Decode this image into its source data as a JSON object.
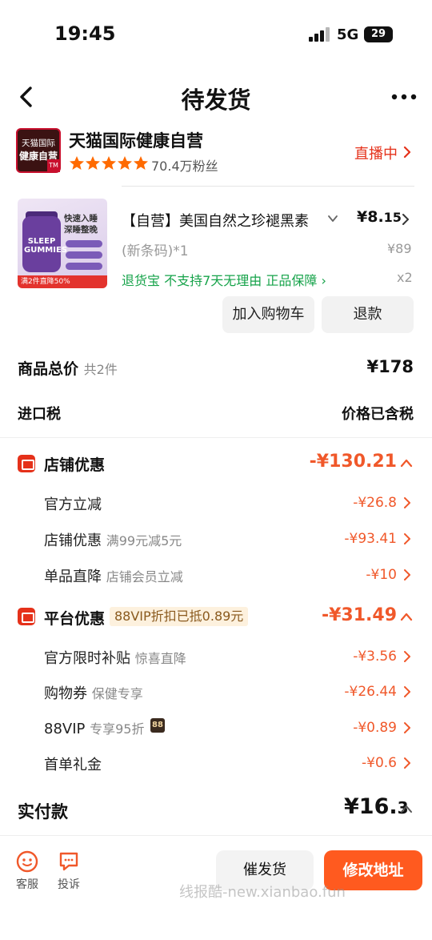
{
  "status_bar": {
    "time": "19:45",
    "network": "5G",
    "battery": "29"
  },
  "nav": {
    "title": "待发货"
  },
  "shop": {
    "logo_line1": "天猫国际",
    "logo_line2": "健康自营",
    "name": "天猫国际健康自营",
    "followers": "70.4万粉丝",
    "live_label": "直播中",
    "rating_stars": 5
  },
  "product": {
    "image_headline": "快速入睡 深睡整晚",
    "image_bottle_text": "SLEEP GUMMIES",
    "image_promo": "满2件直降50%",
    "title": "【自营】美国自然之珍褪黑素",
    "price_main": "¥8.",
    "price_decimal": "15",
    "variant": "(新条码)*1",
    "original_price": "¥89",
    "services": "退货宝  不支持7天无理由  正品保障",
    "quantity": "x2",
    "add_cart": "加入购物车",
    "refund": "退款"
  },
  "summary": {
    "total_label": "商品总价",
    "total_count": "共2件",
    "total_value": "¥178",
    "tax_label": "进口税",
    "tax_value": "价格已含税"
  },
  "store_discount": {
    "title": "店铺优惠",
    "amount": "-¥130.21",
    "items": [
      {
        "label": "官方立减",
        "sub": "",
        "amount": "-¥26.8"
      },
      {
        "label": "店铺优惠",
        "sub": "满99元减5元",
        "amount": "-¥93.41"
      },
      {
        "label": "单品直降",
        "sub": "店铺会员立减",
        "amount": "-¥10"
      }
    ]
  },
  "platform_discount": {
    "title": "平台优惠",
    "tag": "88VIP折扣已抵0.89元",
    "amount": "-¥31.49",
    "items": [
      {
        "label": "官方限时补贴",
        "sub": "惊喜直降",
        "amount": "-¥3.56"
      },
      {
        "label": "购物券",
        "sub": "保健专享",
        "amount": "-¥26.44"
      },
      {
        "label": "88VIP",
        "sub": "专享95折",
        "badge": "88",
        "amount": "-¥0.89"
      },
      {
        "label": "首单礼金",
        "sub": "",
        "amount": "-¥0.6"
      }
    ]
  },
  "payment": {
    "label": "实付款",
    "amount_main": "¥16.",
    "amount_decimal": "3"
  },
  "bottom_bar": {
    "service_label": "客服",
    "complaint_label": "投诉",
    "urge_button": "催发货",
    "address_button": "修改地址",
    "watermark": "线报酷-new.xianbao.fun"
  },
  "colors": {
    "accent_orange": "#f0582a",
    "brand_red": "#e5311a",
    "service_green": "#16a34a",
    "button_orange": "#ff5a1f"
  }
}
